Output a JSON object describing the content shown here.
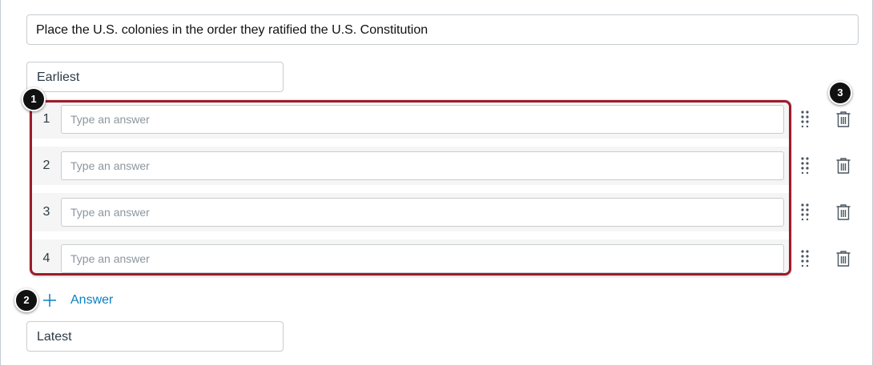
{
  "question": {
    "prompt": "Place the U.S. colonies in the order they ratified the U.S. Constitution"
  },
  "order_labels": {
    "top": "Earliest",
    "bottom": "Latest"
  },
  "answers": [
    {
      "number": "1",
      "placeholder": "Type an answer"
    },
    {
      "number": "2",
      "placeholder": "Type an answer"
    },
    {
      "number": "3",
      "placeholder": "Type an answer"
    },
    {
      "number": "4",
      "placeholder": "Type an answer"
    }
  ],
  "add_answer": {
    "label": "Answer",
    "icon": "plus-icon"
  },
  "row_icons": {
    "drag": "drag-handle-icon",
    "delete": "trash-icon"
  },
  "callouts": {
    "one": "1",
    "two": "2",
    "three": "3"
  },
  "colors": {
    "highlight": "#9b1c2b",
    "link": "#0b80c4",
    "border": "#c7cdd1",
    "row_bg": "#f5f5f5"
  }
}
